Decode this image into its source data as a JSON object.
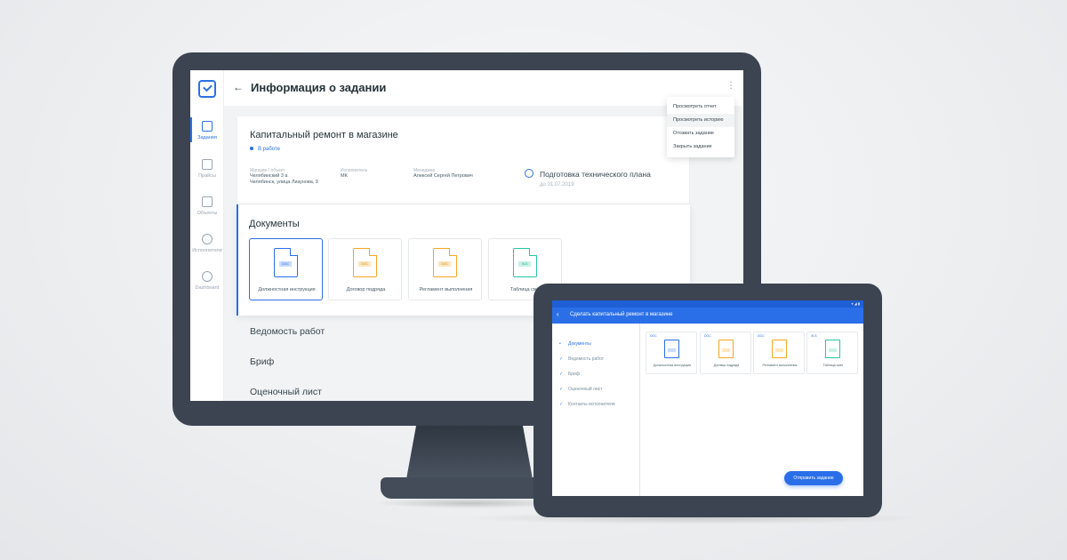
{
  "colors": {
    "accent": "#2b6fe8",
    "orange": "#f5a623",
    "teal": "#26c6a2",
    "frame": "#3b4450"
  },
  "desktop": {
    "header": {
      "back_icon": "arrow-left-icon",
      "title": "Информация о задании",
      "menu_icon": "kebab-menu-icon"
    },
    "sidebar": [
      {
        "label": "Задания",
        "icon": "clipboard-icon",
        "active": true
      },
      {
        "label": "Прайсы",
        "icon": "calendar-icon"
      },
      {
        "label": "Объекты",
        "icon": "building-icon"
      },
      {
        "label": "Исполнители",
        "icon": "users-icon"
      },
      {
        "label": "Dashboard",
        "icon": "pie-chart-icon"
      }
    ],
    "dropdown": [
      "Просмотреть отчет",
      "Просмотреть историю",
      "Отозвать задание",
      "Закрыть задание"
    ],
    "task": {
      "title": "Капитальный ремонт в магазине",
      "status": "В работе",
      "meta": [
        {
          "label": "Магазин / объект",
          "lines": [
            "Челябинский 3 а",
            "Челябинск, улица Лизунова, 9"
          ]
        },
        {
          "label": "Исполнитель",
          "lines": [
            "МК"
          ]
        },
        {
          "label": "Менеджер",
          "lines": [
            "Алексей Сергей Петрович"
          ]
        }
      ],
      "step_title": "Подготовка технического плана",
      "step_date": "до 01.07.2019"
    },
    "documents": {
      "title": "Документы",
      "items": [
        {
          "label": "Должностная инструкция",
          "tag": "DOC",
          "color": "#2b6fe8",
          "selected": true
        },
        {
          "label": "Договор подряда",
          "tag": "DOC",
          "color": "#f5a623"
        },
        {
          "label": "Регламент выполнения",
          "tag": "DOC",
          "color": "#f5a623"
        },
        {
          "label": "Таблица смет",
          "tag": "XLS",
          "color": "#26c6a2"
        }
      ]
    },
    "sections": [
      "Ведомость работ",
      "Бриф",
      "Оценочный лист"
    ]
  },
  "tablet": {
    "title": "Сделать капитальный ремонт в магазине",
    "nav": [
      {
        "label": "Документы",
        "mark": "•",
        "active": true
      },
      {
        "label": "Ведомость работ",
        "mark": "✓"
      },
      {
        "label": "Бриф",
        "mark": "✓"
      },
      {
        "label": "Оценочный лист",
        "mark": "✓"
      },
      {
        "label": "Контакты исполнителя",
        "mark": "✓"
      }
    ],
    "tiles": [
      {
        "cap": "DOC",
        "name": "Должностная инструкция",
        "color": "#2b6fe8"
      },
      {
        "cap": "DOC",
        "name": "Договор подряда",
        "color": "#f5a623"
      },
      {
        "cap": "DOC",
        "name": "Регламент выполнения",
        "color": "#f5a623"
      },
      {
        "cap": "XLS",
        "name": "Таблица смет",
        "color": "#26c6a2"
      }
    ],
    "fab": "Отправить задание"
  }
}
